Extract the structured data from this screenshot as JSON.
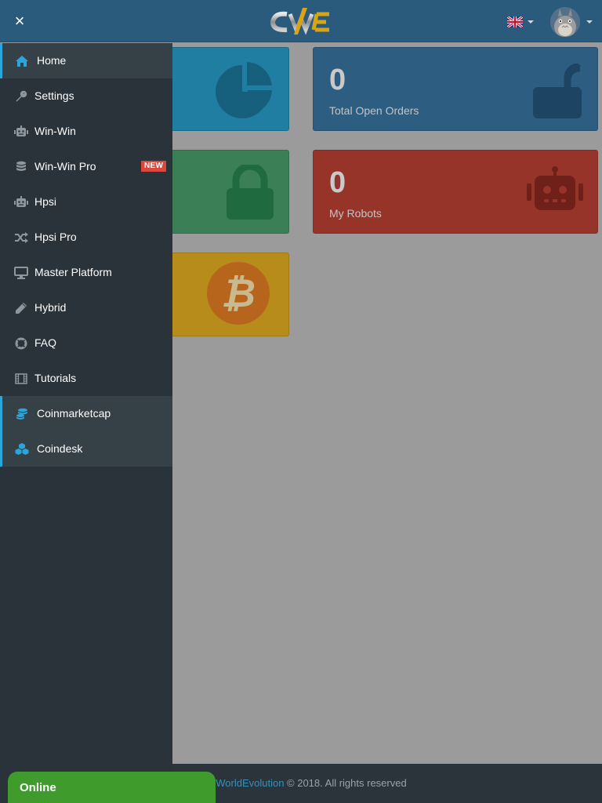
{
  "header": {
    "close_symbol": "×",
    "logo_text": "CWE",
    "language_icon": "uk-flag-icon",
    "avatar_icon": "totoro-avatar-icon"
  },
  "sidebar": {
    "items": [
      {
        "label": "Home",
        "icon": "home-icon"
      },
      {
        "label": "Settings",
        "icon": "wrench-icon"
      },
      {
        "label": "Win-Win",
        "icon": "robot-icon"
      },
      {
        "label": "Win-Win Pro",
        "icon": "database-icon",
        "badge": "NEW"
      },
      {
        "label": "Hpsi",
        "icon": "robot-icon"
      },
      {
        "label": "Hpsi Pro",
        "icon": "shuffle-icon"
      },
      {
        "label": "Master Platform",
        "icon": "desktop-icon"
      },
      {
        "label": "Hybrid",
        "icon": "pencil-icon"
      },
      {
        "label": "FAQ",
        "icon": "life-ring-icon"
      },
      {
        "label": "Tutorials",
        "icon": "film-icon"
      },
      {
        "label": "Coinmarketcap",
        "icon": "coins-icon"
      },
      {
        "label": "Coindesk",
        "icon": "cubes-icon"
      }
    ]
  },
  "tiles": {
    "open_orders": {
      "value": "0",
      "label": "Total Open Orders"
    },
    "my_robots": {
      "value": "0",
      "label": "My Robots"
    }
  },
  "footer": {
    "link_text": "oWorldEvolution",
    "copyright": " © 2018. All rights reserved"
  },
  "chat": {
    "status": "Online"
  },
  "colors": {
    "header": "#2b5b7c",
    "sidebar": "#2a3339",
    "accent": "#2aa6dc",
    "badge_new": "#d9483b",
    "online": "#3f9b2c"
  }
}
